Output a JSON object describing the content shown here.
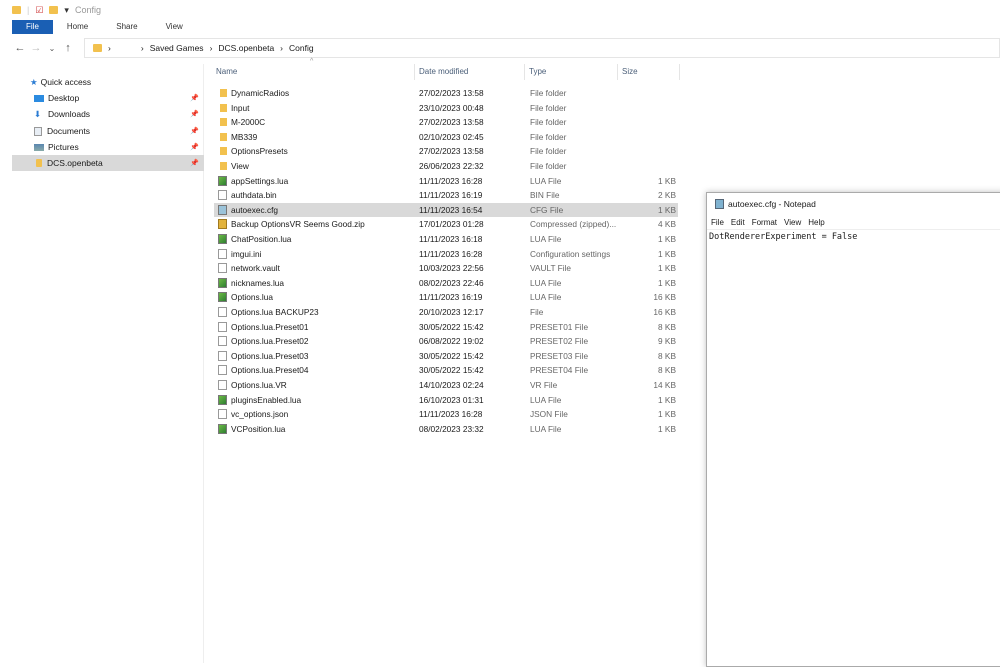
{
  "explorer": {
    "window_title": "Config",
    "ribbon": {
      "file": "File",
      "tabs": [
        "Home",
        "Share",
        "View"
      ]
    },
    "breadcrumb": [
      "Saved Games",
      "DCS.openbeta",
      "Config"
    ],
    "sidebar": {
      "quick_access": "Quick access",
      "items": [
        {
          "label": "Desktop",
          "icon": "desktop-icon",
          "pinned": true
        },
        {
          "label": "Downloads",
          "icon": "download-icon",
          "pinned": true
        },
        {
          "label": "Documents",
          "icon": "documents-icon",
          "pinned": true
        },
        {
          "label": "Pictures",
          "icon": "pictures-icon",
          "pinned": true
        },
        {
          "label": "DCS.openbeta",
          "icon": "folder-icon",
          "pinned": true,
          "selected": true
        }
      ]
    },
    "columns": [
      "Name",
      "Date modified",
      "Type",
      "Size"
    ],
    "files": [
      {
        "name": "DynamicRadios",
        "date": "27/02/2023 13:58",
        "type": "File folder",
        "size": "",
        "icon": "folder"
      },
      {
        "name": "Input",
        "date": "23/10/2023 00:48",
        "type": "File folder",
        "size": "",
        "icon": "folder"
      },
      {
        "name": "M-2000C",
        "date": "27/02/2023 13:58",
        "type": "File folder",
        "size": "",
        "icon": "folder"
      },
      {
        "name": "MB339",
        "date": "02/10/2023 02:45",
        "type": "File folder",
        "size": "",
        "icon": "folder"
      },
      {
        "name": "OptionsPresets",
        "date": "27/02/2023 13:58",
        "type": "File folder",
        "size": "",
        "icon": "folder"
      },
      {
        "name": "View",
        "date": "26/06/2023 22:32",
        "type": "File folder",
        "size": "",
        "icon": "folder"
      },
      {
        "name": "appSettings.lua",
        "date": "11/11/2023 16:28",
        "type": "LUA File",
        "size": "1 KB",
        "icon": "lua"
      },
      {
        "name": "authdata.bin",
        "date": "11/11/2023 16:19",
        "type": "BIN File",
        "size": "2 KB",
        "icon": "file"
      },
      {
        "name": "autoexec.cfg",
        "date": "11/11/2023 16:54",
        "type": "CFG File",
        "size": "1 KB",
        "icon": "cfg",
        "selected": true
      },
      {
        "name": "Backup OptionsVR Seems Good.zip",
        "date": "17/01/2023 01:28",
        "type": "Compressed (zipped)...",
        "size": "4 KB",
        "icon": "zip"
      },
      {
        "name": "ChatPosition.lua",
        "date": "11/11/2023 16:18",
        "type": "LUA File",
        "size": "1 KB",
        "icon": "lua"
      },
      {
        "name": "imgui.ini",
        "date": "11/11/2023 16:28",
        "type": "Configuration settings",
        "size": "1 KB",
        "icon": "file"
      },
      {
        "name": "network.vault",
        "date": "10/03/2023 22:56",
        "type": "VAULT File",
        "size": "1 KB",
        "icon": "file"
      },
      {
        "name": "nicknames.lua",
        "date": "08/02/2023 22:46",
        "type": "LUA File",
        "size": "1 KB",
        "icon": "lua"
      },
      {
        "name": "Options.lua",
        "date": "11/11/2023 16:19",
        "type": "LUA File",
        "size": "16 KB",
        "icon": "lua"
      },
      {
        "name": "Options.lua BACKUP23",
        "date": "20/10/2023 12:17",
        "type": "File",
        "size": "16 KB",
        "icon": "file"
      },
      {
        "name": "Options.lua.Preset01",
        "date": "30/05/2022 15:42",
        "type": "PRESET01 File",
        "size": "8 KB",
        "icon": "file"
      },
      {
        "name": "Options.lua.Preset02",
        "date": "06/08/2022 19:02",
        "type": "PRESET02 File",
        "size": "9 KB",
        "icon": "file"
      },
      {
        "name": "Options.lua.Preset03",
        "date": "30/05/2022 15:42",
        "type": "PRESET03 File",
        "size": "8 KB",
        "icon": "file"
      },
      {
        "name": "Options.lua.Preset04",
        "date": "30/05/2022 15:42",
        "type": "PRESET04 File",
        "size": "8 KB",
        "icon": "file"
      },
      {
        "name": "Options.lua.VR",
        "date": "14/10/2023 02:24",
        "type": "VR File",
        "size": "14 KB",
        "icon": "file"
      },
      {
        "name": "pluginsEnabled.lua",
        "date": "16/10/2023 01:31",
        "type": "LUA File",
        "size": "1 KB",
        "icon": "lua"
      },
      {
        "name": "vc_options.json",
        "date": "11/11/2023 16:28",
        "type": "JSON File",
        "size": "1 KB",
        "icon": "file"
      },
      {
        "name": "VCPosition.lua",
        "date": "08/02/2023 23:32",
        "type": "LUA File",
        "size": "1 KB",
        "icon": "lua"
      }
    ]
  },
  "notepad": {
    "title": "autoexec.cfg - Notepad",
    "menu": [
      "File",
      "Edit",
      "Format",
      "View",
      "Help"
    ],
    "content": "DotRendererExperiment = False"
  }
}
